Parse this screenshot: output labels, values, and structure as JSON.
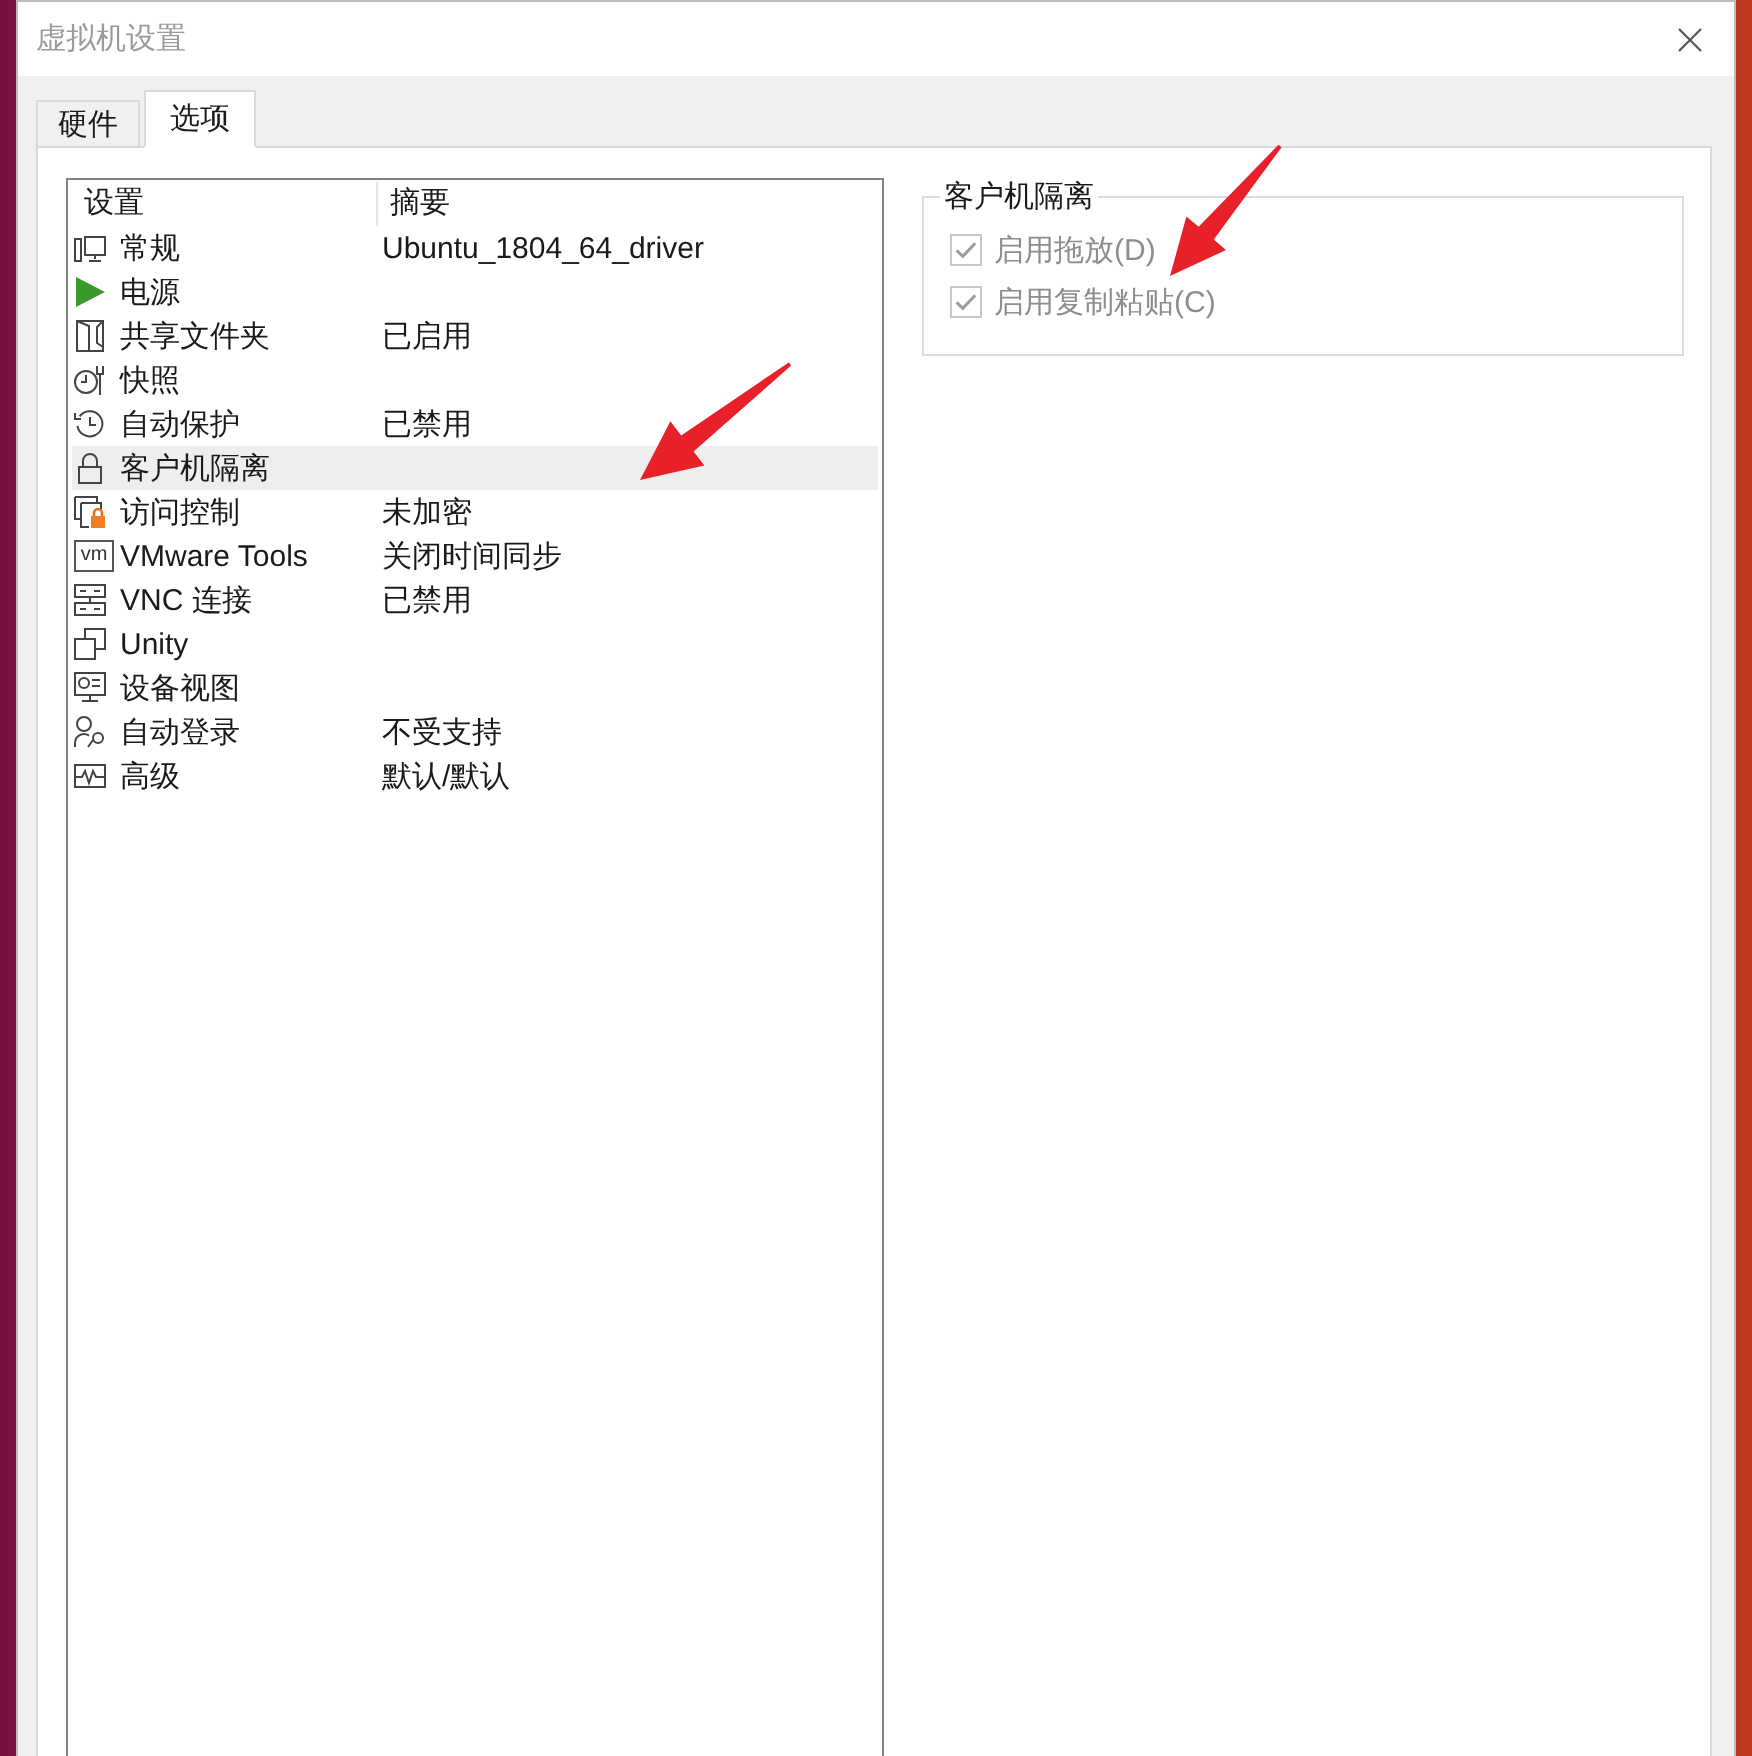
{
  "window": {
    "title": "虚拟机设置"
  },
  "tabs": [
    {
      "label": "硬件",
      "selected": false
    },
    {
      "label": "选项",
      "selected": true
    }
  ],
  "settings_list": {
    "columns": [
      "设置",
      "摘要"
    ],
    "rows": [
      {
        "name": "常规",
        "summary": "Ubuntu_1804_64_driver",
        "selected": false
      },
      {
        "name": "电源",
        "selected": false
      },
      {
        "name": "共享文件夹",
        "summary": "已启用",
        "selected": false
      },
      {
        "name": "快照",
        "selected": false
      },
      {
        "name": "自动保护",
        "summary": "已禁用",
        "selected": false
      },
      {
        "name": "客户机隔离",
        "selected": true
      },
      {
        "name": "访问控制",
        "summary": "未加密",
        "selected": false
      },
      {
        "name": "VMware Tools",
        "summary": "关闭时间同步",
        "selected": false,
        "icon_text": "vm"
      },
      {
        "name": "VNC 连接",
        "summary": "已禁用",
        "selected": false
      },
      {
        "name": "Unity",
        "selected": false
      },
      {
        "name": "设备视图",
        "selected": false
      },
      {
        "name": "自动登录",
        "summary": "不受支持",
        "selected": false
      },
      {
        "name": "高级",
        "summary": "默认/默认",
        "selected": false
      }
    ]
  },
  "isolation_group": {
    "title": "客户机隔离",
    "options": [
      {
        "label": "启用拖放(D)",
        "checked": true,
        "disabled": true
      },
      {
        "label": "启用复制粘贴(C)",
        "checked": true,
        "disabled": true
      }
    ]
  }
}
